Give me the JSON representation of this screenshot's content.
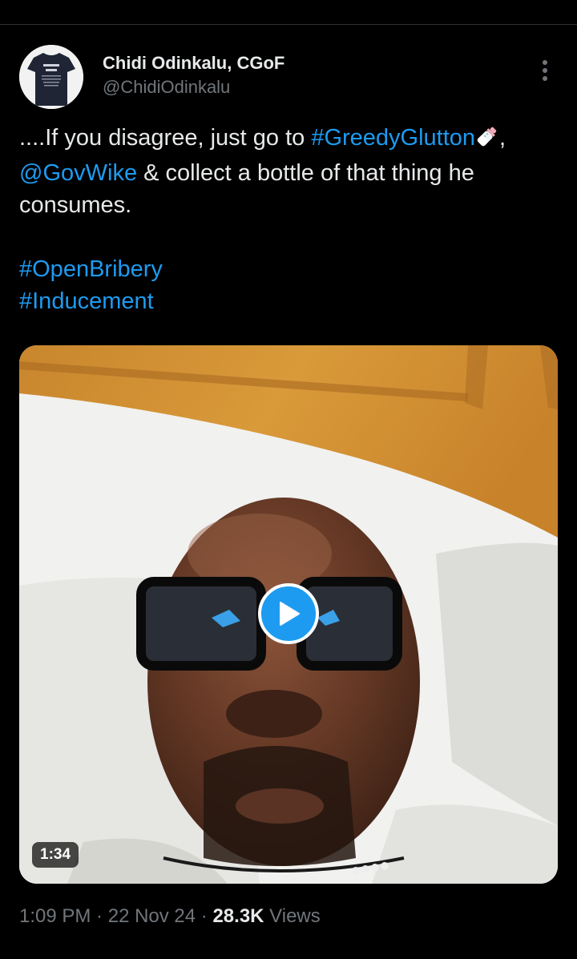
{
  "author": {
    "name": "Chidi Odinkalu, CGoF",
    "handle": "@ChidiOdinkalu",
    "avatar_text_line1": "TOO GOOD",
    "avatar_text_line2": "TO EAT"
  },
  "tweet": {
    "text_start": "....If you disagree, just go to ",
    "hashtag_greedy": "#GreedyGlutton",
    "comma": ",",
    "mention": "@GovWike",
    "text_rest": " & collect a bottle of that thing he consumes.",
    "hashtag_bribery": "#OpenBribery",
    "hashtag_inducement": "#Inducement",
    "emoji": "baby-bottle-icon"
  },
  "media": {
    "type": "video",
    "duration": "1:34",
    "play_icon": "play-icon"
  },
  "meta": {
    "time": "1:09 PM",
    "sep1": " · ",
    "date": "22 Nov 24",
    "sep2": " · ",
    "views_count": "28.3K",
    "views_label": " Views"
  },
  "colors": {
    "background": "#000000",
    "link": "#1d9bf0",
    "text": "#e7e9ea",
    "muted": "#71767b"
  }
}
